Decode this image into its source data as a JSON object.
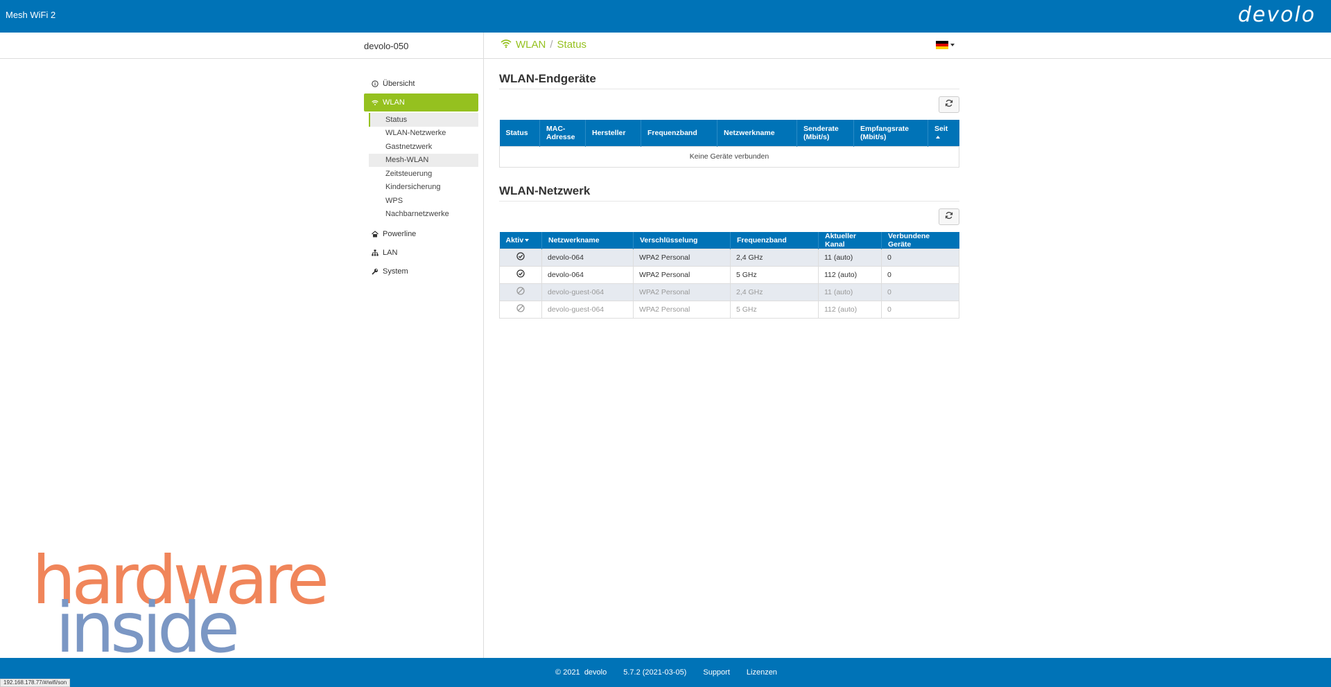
{
  "app": {
    "title": "Mesh WiFi 2",
    "logo_text": "devolo",
    "brand_color": "#0073b7",
    "accent_color": "#95c11f"
  },
  "subheader": {
    "device_name": "devolo-050",
    "breadcrumb": [
      "WLAN",
      "Status"
    ],
    "breadcrumb_separator": "/",
    "language_flag": "flag-de-icon"
  },
  "sidebar": {
    "items": [
      {
        "label": "Übersicht",
        "icon": "info-icon"
      },
      {
        "label": "WLAN",
        "icon": "wifi-icon",
        "active": true
      },
      {
        "label": "Powerline",
        "icon": "home-icon"
      },
      {
        "label": "LAN",
        "icon": "network-icon"
      },
      {
        "label": "System",
        "icon": "wrench-icon"
      }
    ],
    "wlan_subitems": [
      "Status",
      "WLAN-Netzwerke",
      "Gastnetzwerk",
      "Mesh-WLAN",
      "Zeitsteuerung",
      "Kindersicherung",
      "WPS",
      "Nachbarnetzwerke"
    ]
  },
  "clients": {
    "title": "WLAN-Endgeräte",
    "columns": [
      "Status",
      "MAC-Adresse",
      "Hersteller",
      "Frequenzband",
      "Netzwerkname",
      "Senderate (Mbit/s)",
      "Empfangsrate (Mbit/s)",
      "Seit"
    ],
    "empty_text": "Keine Geräte verbunden"
  },
  "networks": {
    "title": "WLAN-Netzwerk",
    "columns": [
      "Aktiv",
      "Netzwerkname",
      "Verschlüsselung",
      "Frequenzband",
      "Aktueller Kanal",
      "Verbundene Geräte"
    ],
    "rows": [
      {
        "active": true,
        "name": "devolo-064",
        "encryption": "WPA2 Personal",
        "band": "2,4 GHz",
        "channel": "11 (auto)",
        "devices": "0"
      },
      {
        "active": true,
        "name": "devolo-064",
        "encryption": "WPA2 Personal",
        "band": "5 GHz",
        "channel": "112 (auto)",
        "devices": "0"
      },
      {
        "active": false,
        "name": "devolo-guest-064",
        "encryption": "WPA2 Personal",
        "band": "2,4 GHz",
        "channel": "11 (auto)",
        "devices": "0"
      },
      {
        "active": false,
        "name": "devolo-guest-064",
        "encryption": "WPA2 Personal",
        "band": "5 GHz",
        "channel": "112 (auto)",
        "devices": "0"
      }
    ]
  },
  "watermark": {
    "line1": "hardware",
    "line2": "inside"
  },
  "footer": {
    "copyright": "© 2021",
    "company": "devolo",
    "version": "5.7.2 (2021-03-05)",
    "support": "Support",
    "licenses": "Lizenzen"
  },
  "statusbar": {
    "url": "192.168.178.77/#/wifi/son"
  }
}
